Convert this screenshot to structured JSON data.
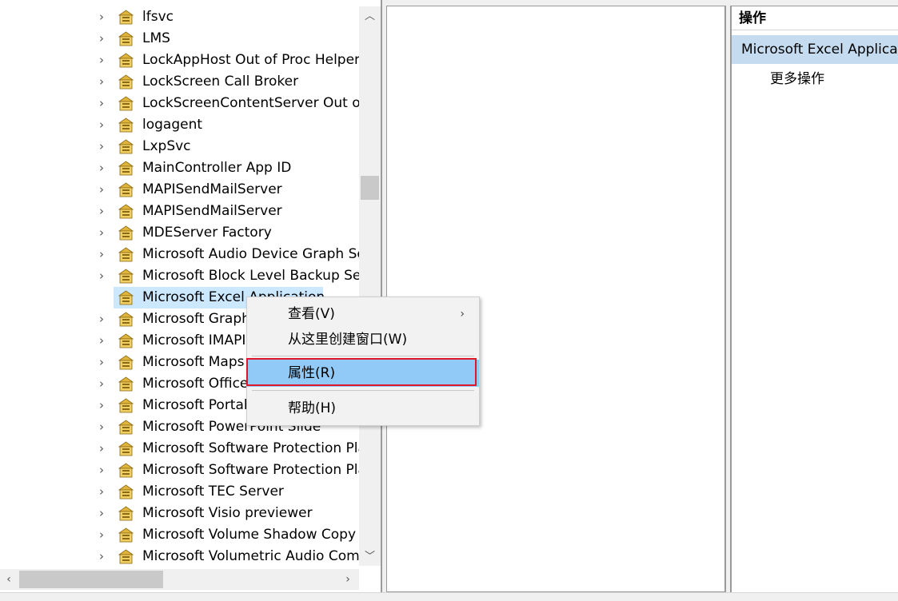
{
  "tree": {
    "items": [
      {
        "label": "lfsvc",
        "expandable": true
      },
      {
        "label": "LMS",
        "expandable": true
      },
      {
        "label": "LockAppHost Out of Proc Helper",
        "expandable": true
      },
      {
        "label": "LockScreen Call Broker",
        "expandable": true
      },
      {
        "label": "LockScreenContentServer Out of",
        "expandable": true
      },
      {
        "label": "logagent",
        "expandable": true
      },
      {
        "label": "LxpSvc",
        "expandable": true
      },
      {
        "label": "MainController App ID",
        "expandable": true
      },
      {
        "label": "MAPISendMailServer",
        "expandable": true
      },
      {
        "label": "MAPISendMailServer",
        "expandable": true
      },
      {
        "label": "MDEServer Factory",
        "expandable": true
      },
      {
        "label": "Microsoft Audio Device Graph Se",
        "expandable": true
      },
      {
        "label": "Microsoft Block Level Backup Serv",
        "expandable": true
      },
      {
        "label": "Microsoft Excel Application",
        "expandable": false,
        "selected": true
      },
      {
        "label": "Microsoft Graph",
        "expandable": true
      },
      {
        "label": "Microsoft IMAPI",
        "expandable": true
      },
      {
        "label": "Microsoft Maps",
        "expandable": true
      },
      {
        "label": "Microsoft Office",
        "expandable": true
      },
      {
        "label": "Microsoft Portab",
        "expandable": true
      },
      {
        "label": "Microsoft PowerPoint Slide",
        "expandable": true
      },
      {
        "label": "Microsoft Software Protection Pla",
        "expandable": true
      },
      {
        "label": "Microsoft Software Protection Pla",
        "expandable": true
      },
      {
        "label": "Microsoft TEC Server",
        "expandable": true
      },
      {
        "label": "Microsoft Visio previewer",
        "expandable": true
      },
      {
        "label": "Microsoft Volume Shadow Copy S",
        "expandable": true
      },
      {
        "label": "Microsoft Volumetric Audio Comp",
        "expandable": true
      }
    ]
  },
  "actions": {
    "header": "操作",
    "main_item": "Microsoft Excel Application",
    "more": "更多操作"
  },
  "context_menu": {
    "items": [
      {
        "label": "查看(V)",
        "submenu": true
      },
      {
        "label": "从这里创建窗口(W)"
      },
      {
        "label": "属性(R)",
        "highlighted": true
      },
      {
        "label": "帮助(H)"
      }
    ]
  },
  "icons": {
    "tree_item": "folder-component-icon",
    "chevron": "chevron-right-icon"
  },
  "colors": {
    "selection": "#cce8ff",
    "menu_highlight": "#91c9f7",
    "annotation_box": "#e0162b",
    "action_selected": "#c5dcf0"
  }
}
